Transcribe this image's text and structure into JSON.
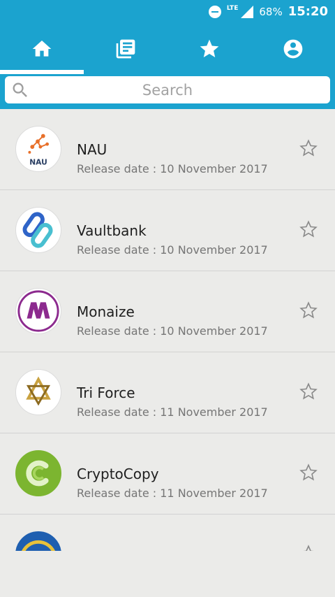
{
  "status_bar": {
    "network": "LTE",
    "battery": "68%",
    "time": "15:20"
  },
  "tabs": [
    {
      "name": "home-icon"
    },
    {
      "name": "list-icon"
    },
    {
      "name": "star-icon"
    },
    {
      "name": "account-icon"
    }
  ],
  "search": {
    "placeholder": "Search"
  },
  "items": [
    {
      "name": "NAU",
      "date": "Release date : 10 November 2017",
      "logo_text": "NAU"
    },
    {
      "name": "Vaultbank",
      "date": "Release date : 10 November 2017"
    },
    {
      "name": "Monaize",
      "date": "Release date : 10 November 2017"
    },
    {
      "name": "Tri Force",
      "date": "Release date : 11 November 2017"
    },
    {
      "name": "CryptoCopy",
      "date": "Release date : 11 November 2017"
    }
  ],
  "colors": {
    "accent": "#1ba3cf",
    "background": "#ebebe9"
  }
}
